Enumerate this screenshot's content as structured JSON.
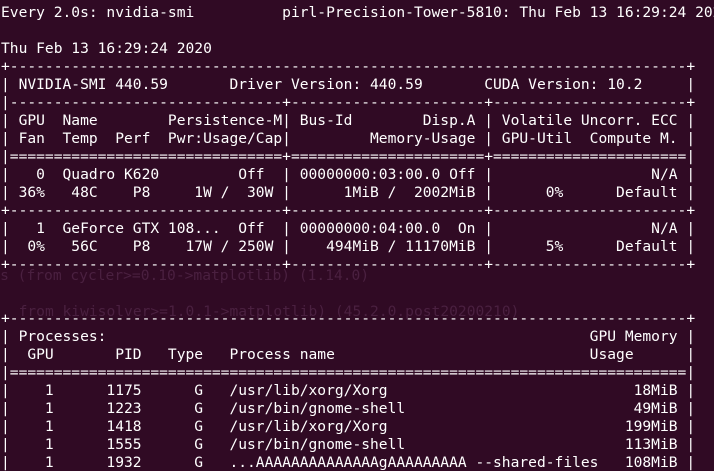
{
  "terminal": {
    "background": "#300a24",
    "foreground": "#ffffff",
    "lines": [
      "Every 2.0s: nvidia-smi          pirl-Precision-Tower-5810: Thu Feb 13 16:29:24 2020",
      "",
      "Thu Feb 13 16:29:24 2020",
      "+-----------------------------------------------------------------------------+",
      "| NVIDIA-SMI 440.59       Driver Version: 440.59       CUDA Version: 10.2     |",
      "|-------------------------------+----------------------+----------------------+",
      "| GPU  Name        Persistence-M| Bus-Id        Disp.A | Volatile Uncorr. ECC |",
      "| Fan  Temp  Perf  Pwr:Usage/Cap|         Memory-Usage | GPU-Util  Compute M. |",
      "|===============================+======================+======================|",
      "|   0  Quadro K620         Off  | 00000000:03:00.0 Off |                  N/A |",
      "| 36%   48C    P8     1W /  30W |      1MiB /  2002MiB |      0%      Default |",
      "+-------------------------------+----------------------+----------------------+",
      "|   1  GeForce GTX 108...  Off  | 00000000:04:00.0  On |                  N/A |",
      "|  0%   56C    P8    17W / 250W |    494MiB / 11170MiB |      5%      Default |",
      "+-------------------------------+----------------------+----------------------+",
      "",
      "",
      "+-----------------------------------------------------------------------------+",
      "| Processes:                                                       GPU Memory |",
      "|  GPU       PID   Type   Process name                             Usage      |",
      "|=============================================================================|",
      "|    1      1175      G   /usr/lib/xorg/Xorg                            18MiB |",
      "|    1      1223      G   /usr/bin/gnome-shell                          49MiB |",
      "|    1      1418      G   /usr/lib/xorg/Xorg                           199MiB |",
      "|    1      1555      G   /usr/bin/gnome-shell                         113MiB |",
      "|    1      1932      G   ...AAAAAAAAAAAAAAgAAAAAAAAA --shared-files   108MiB |",
      "+-----------------------------------------------------------------------------+"
    ],
    "ghost_texts": [
      {
        "text": "s (from cycler>=0.10->matplotlib) (1.14.0)",
        "row": 14.6,
        "col": -0.1
      },
      {
        "text": "from kiwisolver>=1.0.1->matplotlib) (45.2.0.post20200210)",
        "row": 16.6,
        "col": 2
      }
    ]
  }
}
